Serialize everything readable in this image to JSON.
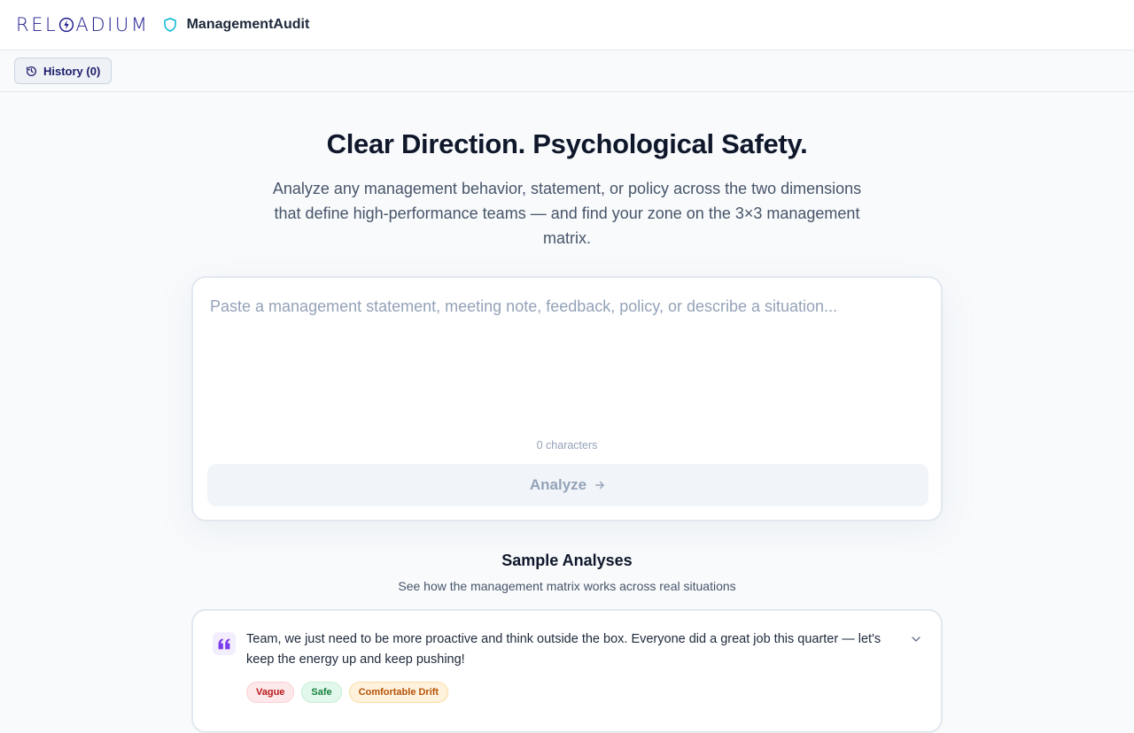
{
  "header": {
    "logo_left": "REL",
    "logo_right": "ADIUM",
    "app_name": "ManagementAudit"
  },
  "toolbar": {
    "history_label": "History (0)"
  },
  "hero": {
    "title": "Clear Direction. Psychological Safety.",
    "subtitle": "Analyze any management behavior, statement, or policy across the two dimensions that define high-performance teams — and find your zone on the 3×3 management matrix."
  },
  "input": {
    "placeholder": "Paste a management statement, meeting note, feedback, policy, or describe a situation...",
    "value": "",
    "char_count": "0 characters",
    "analyze_label": "Analyze"
  },
  "samples": {
    "title": "Sample Analyses",
    "subtitle": "See how the management matrix works across real situations",
    "items": [
      {
        "text": "Team, we just need to be more proactive and think outside the box. Everyone did a great job this quarter — let's keep the energy up and keep pushing!",
        "tags": [
          "Vague",
          "Safe",
          "Comfortable Drift"
        ]
      }
    ]
  },
  "colors": {
    "brand": "#1e1b8f",
    "accent": "#06b6d4",
    "quote": "#7c3aed"
  },
  "icons": {
    "logo": "bolt-circle-icon",
    "shield": "shield-icon",
    "history": "history-icon",
    "analyze": "arrow-right-icon",
    "quote": "quote-icon",
    "expand": "chevron-down-icon"
  }
}
